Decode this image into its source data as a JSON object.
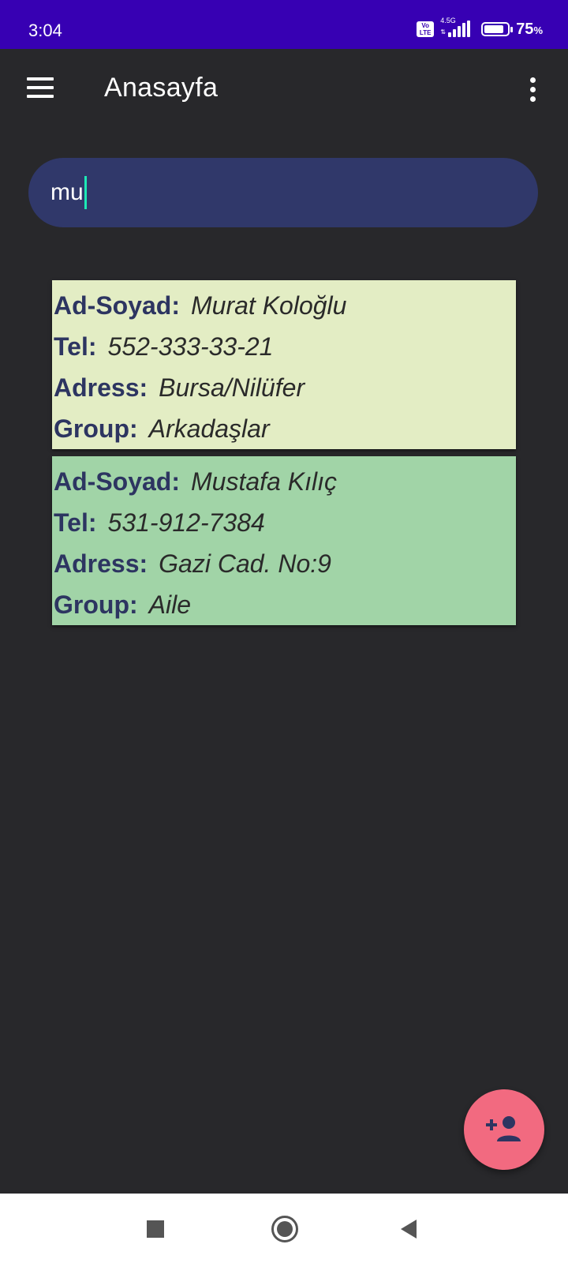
{
  "status_bar": {
    "time": "3:04",
    "volte": "Vo LTE",
    "network": "4.5G",
    "battery_pct": "75",
    "battery_unit": "%"
  },
  "app_bar": {
    "title": "Anasayfa"
  },
  "search": {
    "value": "mu"
  },
  "contacts": [
    {
      "name_label": "Ad-Soyad:",
      "name": "Murat Koloğlu",
      "tel_label": "Tel:",
      "tel": "552-333-33-21",
      "address_label": "Adress:",
      "address": "Bursa/Nilüfer",
      "group_label": "Group:",
      "group": "Arkadaşlar",
      "color": "#e3edc4"
    },
    {
      "name_label": "Ad-Soyad:",
      "name": "Mustafa Kılıç",
      "tel_label": "Tel:",
      "tel": "531-912-7384",
      "address_label": "Adress:",
      "address": "Gazi Cad. No:9",
      "group_label": "Group:",
      "group": "Aile",
      "color": "#a1d4a7"
    }
  ],
  "fab": {
    "icon": "add-person-icon",
    "color": "#f26a80"
  },
  "colors": {
    "status_bar": "#3700b3",
    "background": "#28282b",
    "search_bg": "#30386a",
    "label_text": "#2d3561"
  }
}
